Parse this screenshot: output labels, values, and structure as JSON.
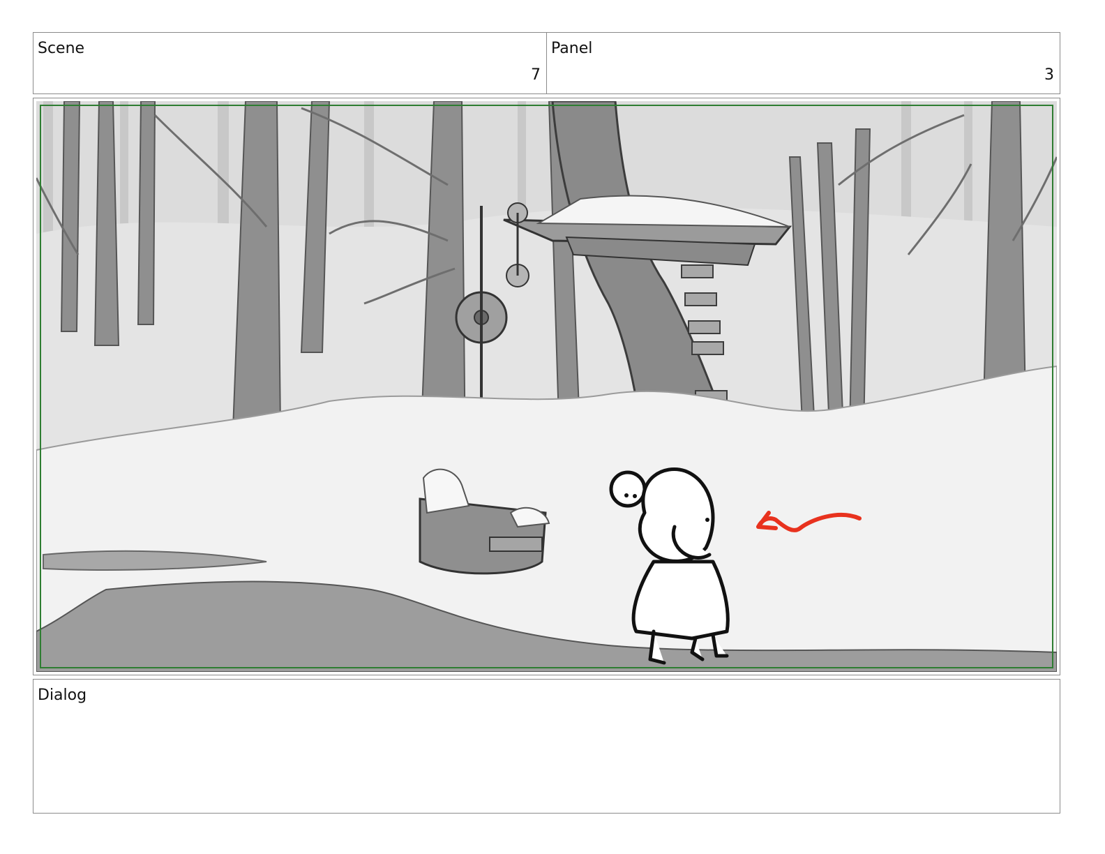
{
  "scene": {
    "label": "Scene",
    "value": "7"
  },
  "panel": {
    "label": "Panel",
    "value": "3"
  },
  "dialog": {
    "label": "Dialog",
    "text": ""
  },
  "colors": {
    "safe_area": "#2e7d32",
    "motion_arrow": "#e8321e",
    "sky": "#d6d6d6",
    "snow": "#f4f4f4",
    "tree": "#8d8d8d",
    "water": "#9a9a9a"
  },
  "artwork": {
    "icons": [
      "tree-icon",
      "well-icon",
      "pulley-icon",
      "treehouse-icon",
      "character-icon",
      "arrow-icon"
    ]
  }
}
